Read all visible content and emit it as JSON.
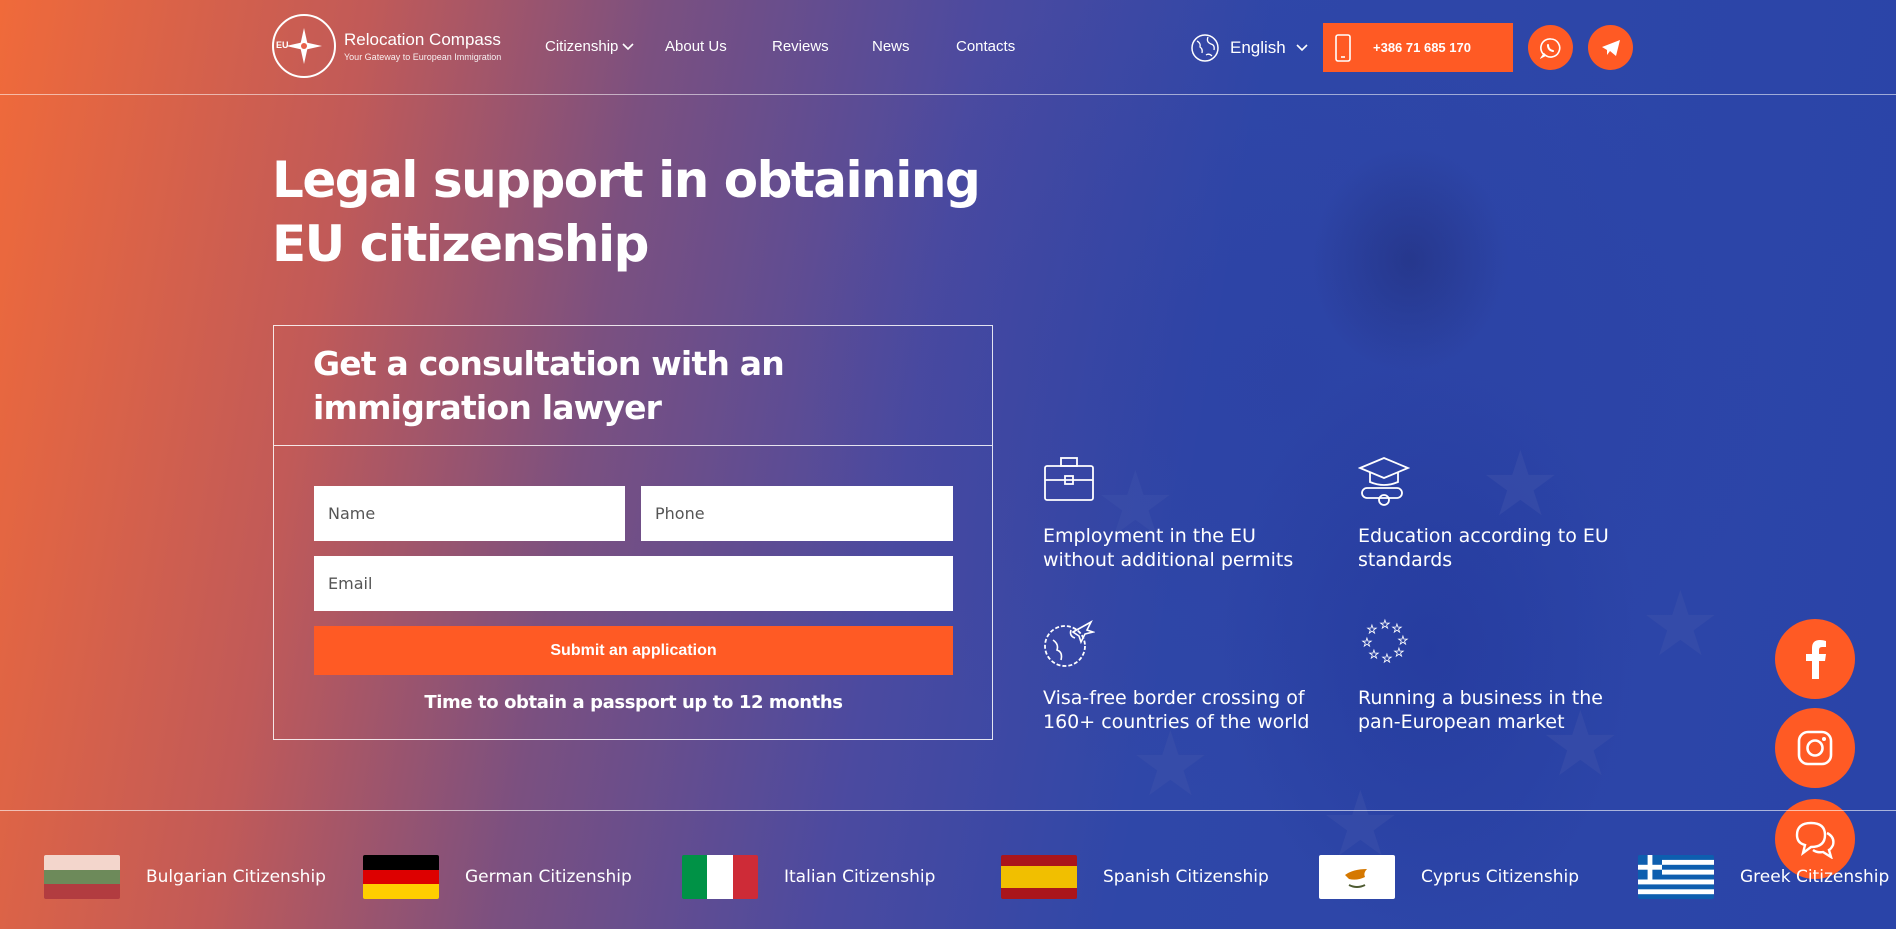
{
  "brand": {
    "name": "Relocation Compass",
    "tagline": "Your Gateway to European Immigration",
    "badge": "EU"
  },
  "nav": {
    "items": [
      "Citizenship",
      "About Us",
      "Reviews",
      "News",
      "Contacts"
    ]
  },
  "language": {
    "selected": "English"
  },
  "contact": {
    "phone": "+386 71 685 170"
  },
  "hero": {
    "title": "Legal support in obtaining EU citizenship"
  },
  "form": {
    "title": "Get a consultation with an immigration lawyer",
    "name_placeholder": "Name",
    "phone_placeholder": "Phone",
    "email_placeholder": "Email",
    "submit_label": "Submit an application",
    "note": "Time to obtain a passport up to 12 months"
  },
  "features": [
    {
      "icon": "briefcase-icon",
      "text": "Employment in the EU without additional permits"
    },
    {
      "icon": "graduation-cap-icon",
      "text": "Education according to EU standards"
    },
    {
      "icon": "globe-plane-icon",
      "text": "Visa-free border crossing of 160+ countries of the world"
    },
    {
      "icon": "eu-stars-icon",
      "text": "Running a business in the pan-European market"
    }
  ],
  "social": [
    "facebook-icon",
    "instagram-icon",
    "chat-icon"
  ],
  "countries": [
    {
      "label": "Bulgarian Citizenship",
      "colors": [
        "#ffffff",
        "#00966e",
        "#d62612"
      ]
    },
    {
      "label": "German Citizenship",
      "colors": [
        "#000000",
        "#dd0000",
        "#ffce00"
      ]
    },
    {
      "label": "Italian Citizenship",
      "colors": [
        "#009246",
        "#ffffff",
        "#ce2b37"
      ]
    },
    {
      "label": "Spanish Citizenship",
      "colors": [
        "#aa151b",
        "#f1bf00",
        "#aa151b"
      ]
    },
    {
      "label": "Cyprus Citizenship",
      "colors": [
        "#ffffff",
        "#d57800"
      ]
    },
    {
      "label": "Greek Citizenship",
      "colors": [
        "#0d5eaf",
        "#ffffff"
      ]
    }
  ],
  "theme": {
    "accent": "#ff5a24",
    "background_left": "#f06a3a",
    "background_right": "#2a44a8"
  }
}
